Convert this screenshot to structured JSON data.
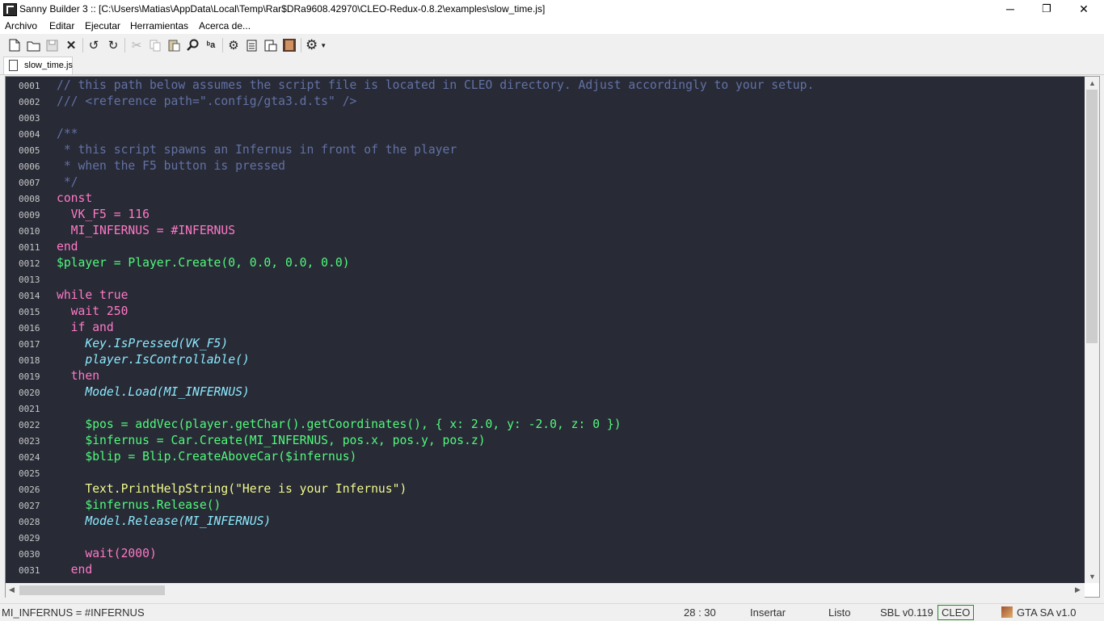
{
  "window": {
    "title": "Sanny Builder 3 :: [C:\\Users\\Matias\\AppData\\Local\\Temp\\Rar$DRa9608.42970\\CLEO-Redux-0.8.2\\examples\\slow_time.js]",
    "minimize": "─",
    "restore": "❐",
    "close": "✕"
  },
  "menu": [
    "Archivo",
    "Editar",
    "Ejecutar",
    "Herramientas",
    "Acerca de..."
  ],
  "toolbar_icons": [
    "new-file-icon",
    "open-folder-icon",
    "save-icon",
    "close-file-icon",
    "undo-icon",
    "redo-icon",
    "cut-icon",
    "copy-icon",
    "paste-icon",
    "find-icon",
    "replace-icon",
    "compile-icon",
    "compile-settings-icon",
    "decompile-icon",
    "run-game-icon",
    "options-gear-icon"
  ],
  "tabs": [
    {
      "label": "slow_time.js"
    }
  ],
  "editor": {
    "lines": [
      {
        "num": "0001",
        "text": "// this path below assumes the script file is located in CLEO directory. Adjust accordingly to your setup."
      },
      {
        "num": "0002",
        "text": "/// <reference path=\".config/gta3.d.ts\" />"
      },
      {
        "num": "0003",
        "text": ""
      },
      {
        "num": "0004",
        "text": "/**"
      },
      {
        "num": "0005",
        "text": " * this script spawns an Infernus in front of the player"
      },
      {
        "num": "0006",
        "text": " * when the F5 button is pressed"
      },
      {
        "num": "0007",
        "text": " */"
      },
      {
        "num": "0008",
        "text": "const"
      },
      {
        "num": "0009",
        "text": "  VK_F5 = 116"
      },
      {
        "num": "0010",
        "text": "  MI_INFERNUS = #INFERNUS"
      },
      {
        "num": "0011",
        "text": "end"
      },
      {
        "num": "0012",
        "text": "$player = Player.Create(0, 0.0, 0.0, 0.0)"
      },
      {
        "num": "0013",
        "text": ""
      },
      {
        "num": "0014",
        "text": "while true"
      },
      {
        "num": "0015",
        "text": "  wait 250"
      },
      {
        "num": "0016",
        "text": "  if and"
      },
      {
        "num": "0017",
        "text": "    Key.IsPressed(VK_F5)"
      },
      {
        "num": "0018",
        "text": "    player.IsControllable()"
      },
      {
        "num": "0019",
        "text": "  then"
      },
      {
        "num": "0020",
        "text": "    Model.Load(MI_INFERNUS)"
      },
      {
        "num": "0021",
        "text": ""
      },
      {
        "num": "0022",
        "text": "    $pos = addVec(player.getChar().getCoordinates(), { x: 2.0, y: -2.0, z: 0 })"
      },
      {
        "num": "0023",
        "text": "    $infernus = Car.Create(MI_INFERNUS, pos.x, pos.y, pos.z)"
      },
      {
        "num": "0024",
        "text": "    $blip = Blip.CreateAboveCar($infernus)"
      },
      {
        "num": "0025",
        "text": ""
      },
      {
        "num": "0026",
        "text": "    Text.PrintHelpString(\"Here is your Infernus\")"
      },
      {
        "num": "0027",
        "text": "    $infernus.Release()"
      },
      {
        "num": "0028",
        "text": "    Model.Release(MI_INFERNUS)"
      },
      {
        "num": "0029",
        "text": ""
      },
      {
        "num": "0030",
        "text": "    wait(2000)"
      },
      {
        "num": "0031",
        "text": "  end"
      }
    ]
  },
  "status": {
    "message": "MI_INFERNUS = #INFERNUS",
    "cursor": "28 : 30",
    "mode": "Insertar",
    "state": "Listo",
    "sbl_version": "SBL v0.119",
    "edit_mode": "CLEO",
    "game": "GTA SA v1.0"
  },
  "colors": {
    "editor_bg": "#282a36",
    "keyword": "#ff79c6",
    "comment": "#6272a4",
    "number": "#bd93f9",
    "class": "#8be9fd",
    "method": "#50fa7b",
    "string": "#f1fa8c",
    "text": "#f8f8f2"
  }
}
